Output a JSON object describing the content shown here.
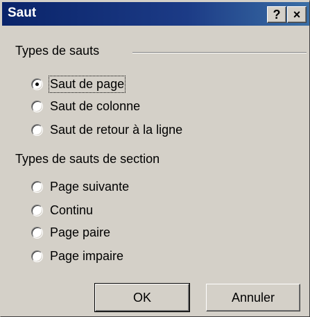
{
  "window": {
    "title": "Saut",
    "help_label": "?",
    "close_label": "×"
  },
  "break_types": {
    "heading": "Types de sauts",
    "options": [
      {
        "label": "Saut de page",
        "checked": true
      },
      {
        "label": "Saut de colonne",
        "checked": false
      },
      {
        "label": "Saut de retour à la ligne",
        "checked": false
      }
    ]
  },
  "section_break_types": {
    "heading": "Types de sauts de section",
    "options": [
      {
        "label": "Page suivante",
        "checked": false
      },
      {
        "label": "Continu",
        "checked": false
      },
      {
        "label": "Page paire",
        "checked": false
      },
      {
        "label": "Page impaire",
        "checked": false
      }
    ]
  },
  "buttons": {
    "ok": "OK",
    "cancel": "Annuler"
  }
}
